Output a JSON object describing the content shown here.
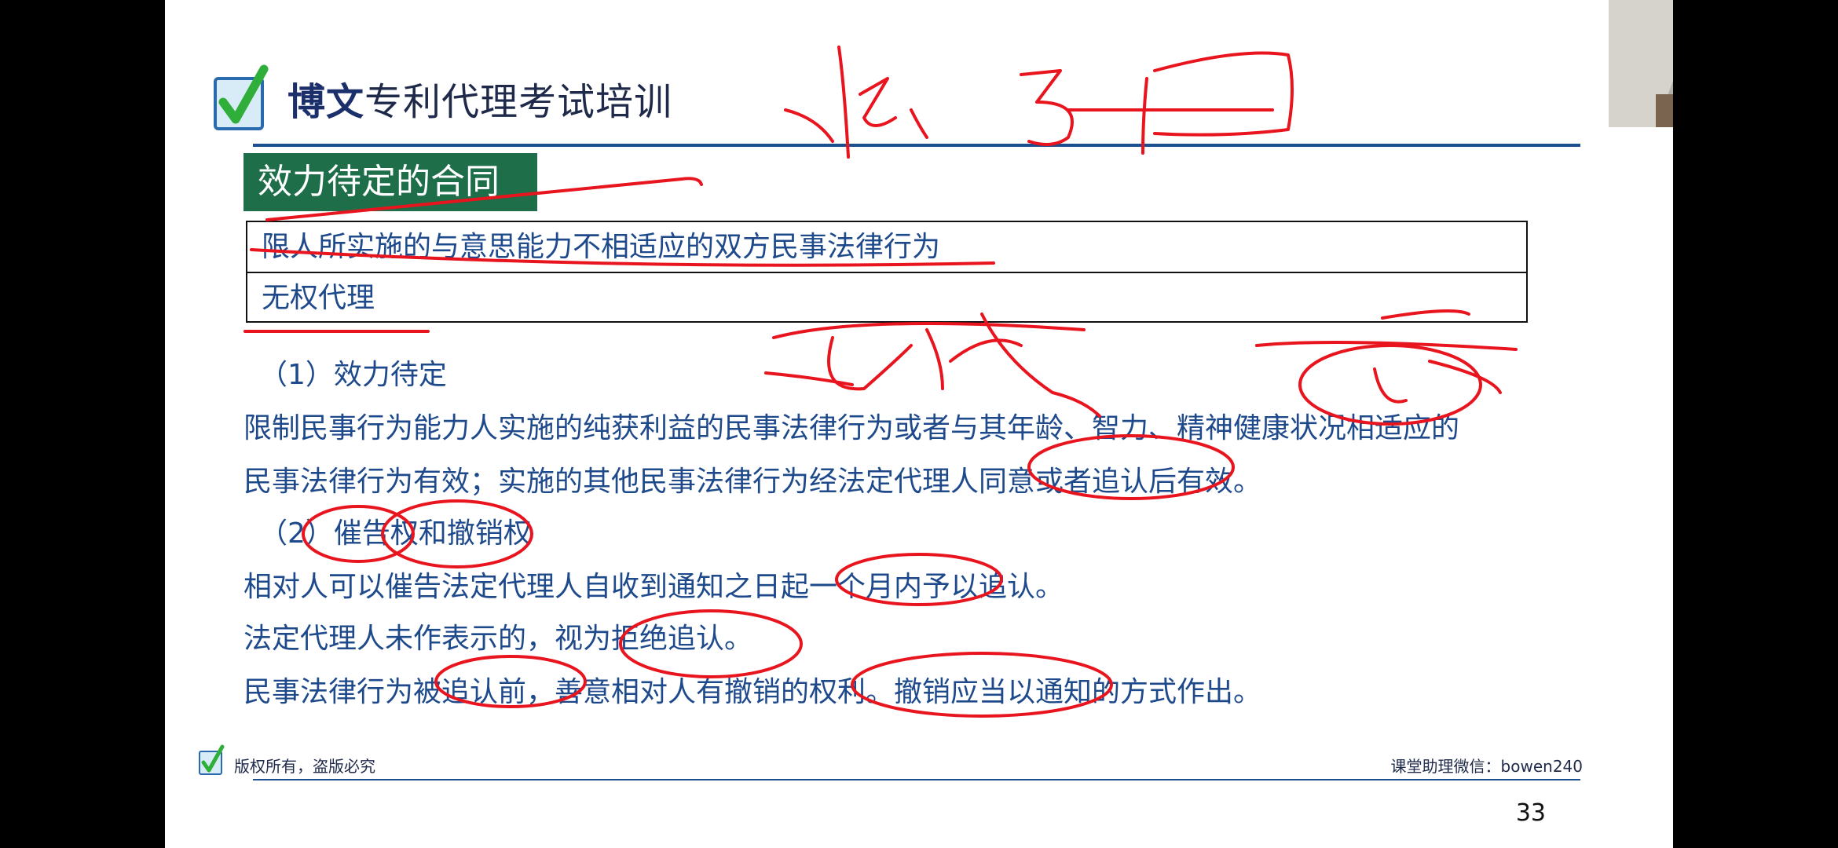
{
  "header": {
    "brand": "博文",
    "title_rest": "专利代理考试培训"
  },
  "section_badge": "效力待定的合同",
  "case_table": {
    "rows": [
      "限人所实施的与意思能力不相适应的双方民事法律行为",
      "无权代理"
    ]
  },
  "body": {
    "point1_heading": "（1）效力待定",
    "point1_line1": "限制民事行为能力人实施的纯获利益的民事法律行为或者与其年龄、智力、精神健康状况相适应的",
    "point1_line2": "民事法律行为有效；实施的其他民事法律行为经法定代理人同意或者追认后有效。",
    "point2_heading": "（2）催告权和撤销权",
    "point2_line1": "相对人可以催告法定代理人自收到通知之日起一个月内予以追认。",
    "point2_line2": "法定代理人未作表示的，视为拒绝追认。",
    "point2_line3": "民事法律行为被追认前，善意相对人有撤销的权利。撤销应当以通知的方式作出。"
  },
  "footer": {
    "copyright": "版权所有，盗版必究",
    "contact": "课堂助理微信：bowen240"
  },
  "page_number": "33",
  "icons": {
    "logo": "checkmark-logo-icon",
    "footer_logo": "checkmark-logo-icon"
  },
  "colors": {
    "text_blue": "#1e4a8c",
    "badge_green": "#1e6e4a",
    "rule_blue": "#1b4f8f",
    "ink_red": "#e8141e",
    "logo_green": "#2fae3a",
    "logo_blue": "#2a6bb0"
  }
}
